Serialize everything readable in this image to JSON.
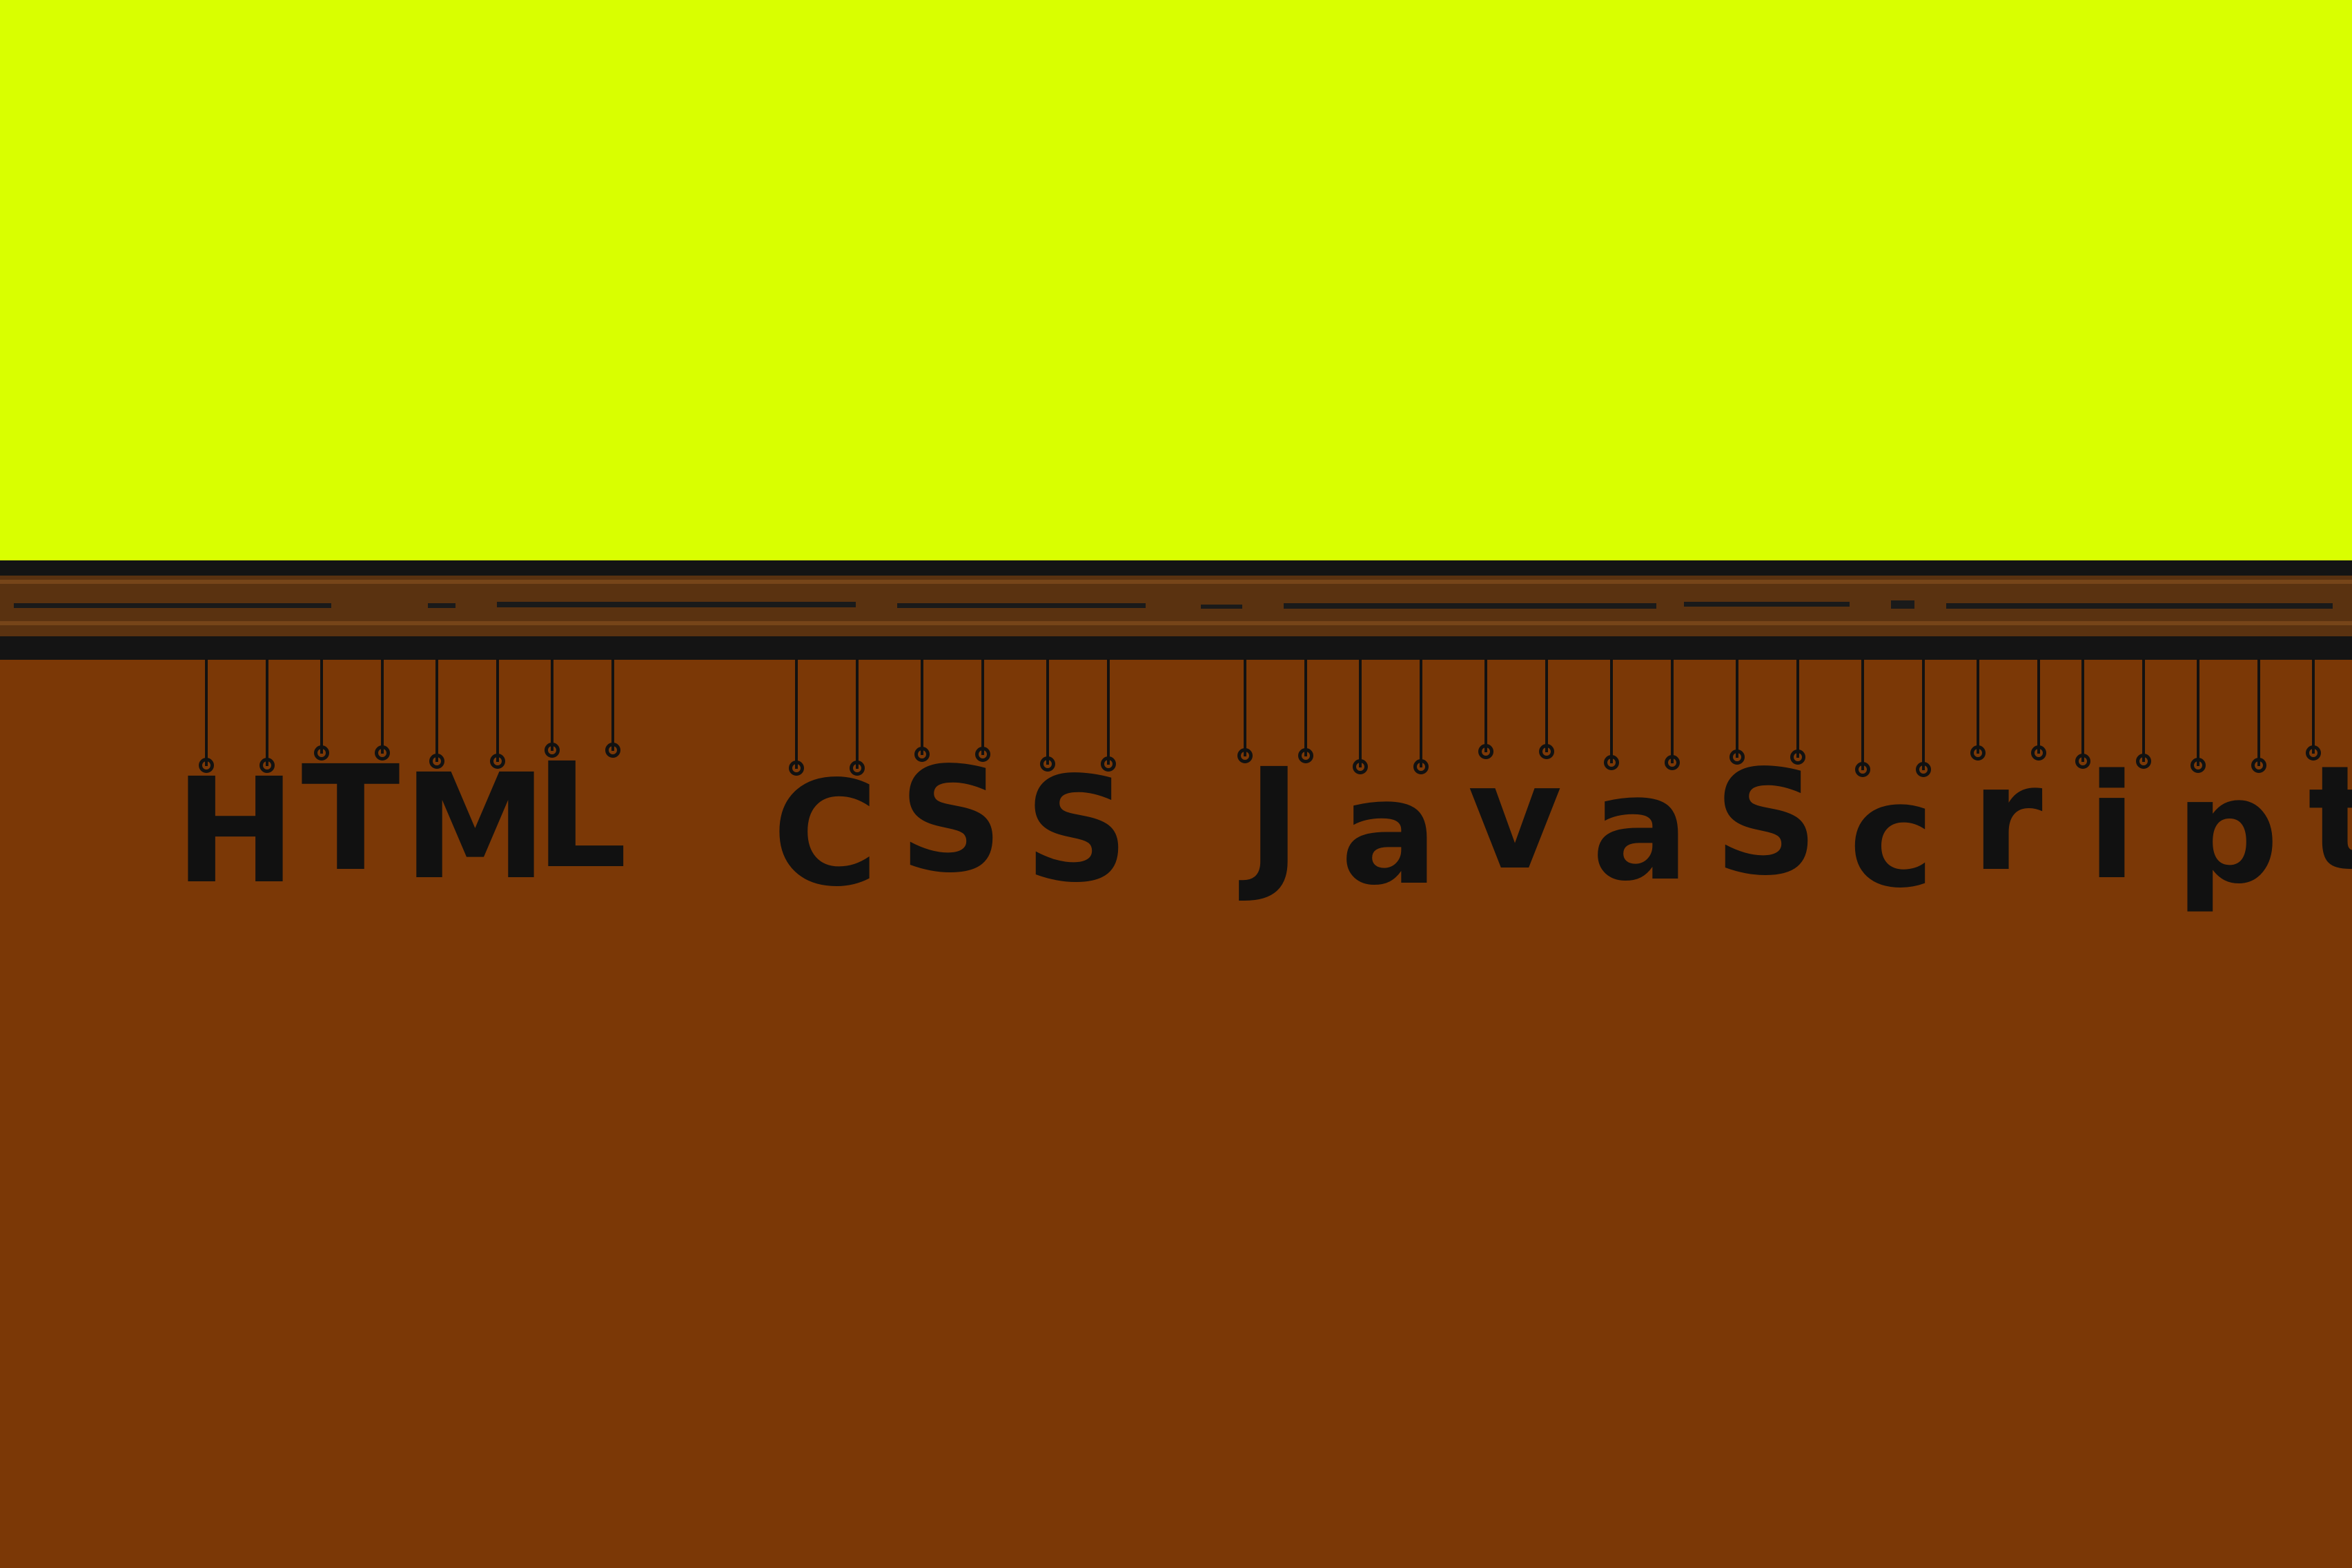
{
  "colors": {
    "top_background": "#d9ff00",
    "bottom_background": "#7b3806",
    "shelf_dark": "#141414",
    "shelf_texture": "#6a3a12",
    "ink": "#111111"
  },
  "banner": {
    "text": "HTML CSS JavaScript",
    "words": [
      "HTML",
      "CSS",
      "JavaScript"
    ]
  }
}
